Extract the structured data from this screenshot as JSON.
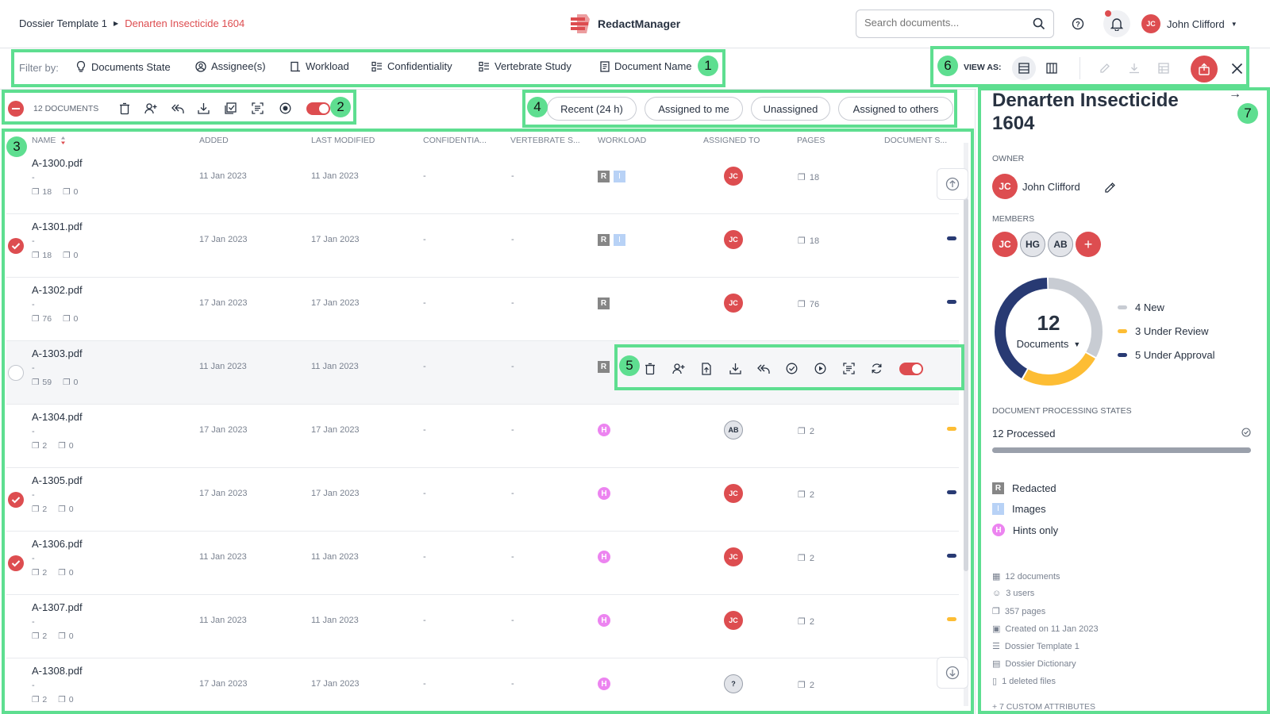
{
  "header": {
    "breadcrumb_parent": "Dossier Template 1",
    "breadcrumb_current": "Denarten Insecticide 1604",
    "app_name": "RedactManager",
    "search_placeholder": "Search documents...",
    "user_initials": "JC",
    "user_name": "John Clifford"
  },
  "filters": {
    "label": "Filter by:",
    "items": [
      "Documents State",
      "Assignee(s)",
      "Workload",
      "Confidentiality",
      "Vertebrate Study",
      "Document Name"
    ]
  },
  "view": {
    "label": "VIEW AS:"
  },
  "bulk": {
    "count_label": "12 DOCUMENTS"
  },
  "quick_filters": [
    "Recent (24 h)",
    "Assigned to me",
    "Unassigned",
    "Assigned to others"
  ],
  "columns": [
    "NAME",
    "ADDED",
    "LAST MODIFIED",
    "CONFIDENTIA...",
    "VERTEBRATE S...",
    "WORKLOAD",
    "ASSIGNED TO",
    "PAGES",
    "DOCUMENT S..."
  ],
  "rows": [
    {
      "name": "A-1300.pdf",
      "sub": "-",
      "pages_mini": "18",
      "files_mini": "0",
      "added": "11 Jan 2023",
      "modified": "11 Jan 2023",
      "conf": "-",
      "vert": "-",
      "assignee": "JC",
      "pages": "18"
    },
    {
      "name": "A-1301.pdf",
      "sub": "-",
      "pages_mini": "18",
      "files_mini": "0",
      "added": "17 Jan 2023",
      "modified": "17 Jan 2023",
      "conf": "-",
      "vert": "-",
      "assignee": "JC",
      "pages": "18"
    },
    {
      "name": "A-1302.pdf",
      "sub": "-",
      "pages_mini": "76",
      "files_mini": "0",
      "added": "17 Jan 2023",
      "modified": "17 Jan 2023",
      "conf": "-",
      "vert": "-",
      "assignee": "JC",
      "pages": "76"
    },
    {
      "name": "A-1303.pdf",
      "sub": "-",
      "pages_mini": "59",
      "files_mini": "0",
      "added": "11 Jan 2023",
      "modified": "11 Jan 2023",
      "conf": "-",
      "vert": "-",
      "assignee": "",
      "pages": ""
    },
    {
      "name": "A-1304.pdf",
      "sub": "-",
      "pages_mini": "2",
      "files_mini": "0",
      "added": "17 Jan 2023",
      "modified": "17 Jan 2023",
      "conf": "-",
      "vert": "-",
      "assignee": "AB",
      "pages": "2"
    },
    {
      "name": "A-1305.pdf",
      "sub": "-",
      "pages_mini": "2",
      "files_mini": "0",
      "added": "17 Jan 2023",
      "modified": "17 Jan 2023",
      "conf": "-",
      "vert": "-",
      "assignee": "JC",
      "pages": "2"
    },
    {
      "name": "A-1306.pdf",
      "sub": "-",
      "pages_mini": "2",
      "files_mini": "0",
      "added": "11 Jan 2023",
      "modified": "11 Jan 2023",
      "conf": "-",
      "vert": "-",
      "assignee": "JC",
      "pages": "2"
    },
    {
      "name": "A-1307.pdf",
      "sub": "-",
      "pages_mini": "2",
      "files_mini": "0",
      "added": "11 Jan 2023",
      "modified": "11 Jan 2023",
      "conf": "-",
      "vert": "-",
      "assignee": "JC",
      "pages": "2"
    },
    {
      "name": "A-1308.pdf",
      "sub": "-",
      "pages_mini": "2",
      "files_mini": "0",
      "added": "17 Jan 2023",
      "modified": "17 Jan 2023",
      "conf": "-",
      "vert": "-",
      "assignee": "?",
      "pages": "2"
    }
  ],
  "row_letters": {
    "r": "R",
    "i": "I",
    "h": "H"
  },
  "sidebar": {
    "title_line1": "Denarten Insecticide",
    "title_line2": "1604",
    "owner_label": "OWNER",
    "owner_initials": "JC",
    "owner_name": "John Clifford",
    "members_label": "MEMBERS",
    "members": [
      "JC",
      "HG",
      "AB"
    ],
    "add_member": "+",
    "donut_count": "12",
    "donut_label": "Documents",
    "states": [
      {
        "label": "4 New",
        "count": 4,
        "color": "#c8ccd3"
      },
      {
        "label": "3 Under Review",
        "count": 3,
        "color": "#fdbd34"
      },
      {
        "label": "5 Under Approval",
        "count": 5,
        "color": "#283a73"
      }
    ],
    "processing_label": "DOCUMENT PROCESSING STATES",
    "processed_text": "12 Processed",
    "processed_fraction": 1.0,
    "legend": [
      {
        "letter": "R",
        "label": "Redacted"
      },
      {
        "letter": "I",
        "label": "Images"
      },
      {
        "letter": "H",
        "label": "Hints only"
      }
    ],
    "meta": [
      "12 documents",
      "3 users",
      "357 pages",
      "Created on 11 Jan 2023",
      "Dossier Template 1",
      "Dossier Dictionary",
      "1 deleted files"
    ],
    "custom_attrs": "+ 7 CUSTOM ATTRIBUTES"
  },
  "annotations": [
    "1",
    "2",
    "3",
    "4",
    "5",
    "6",
    "7"
  ],
  "colors": {
    "brand_red": "#dd4d50",
    "highlight_green": "#5ede90",
    "navy": "#283a73",
    "amber": "#fdbd34"
  }
}
